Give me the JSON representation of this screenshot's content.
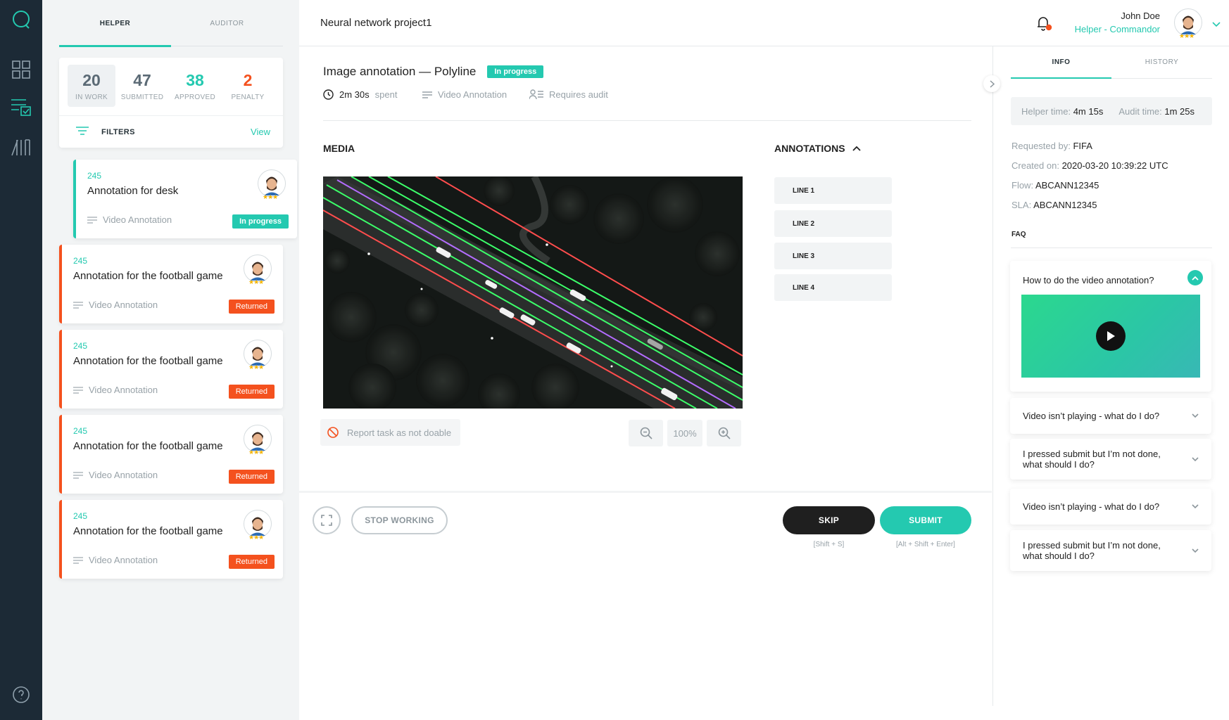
{
  "rail": {
    "icons": [
      "logo-icon",
      "dashboard-icon",
      "tasks-icon",
      "library-icon",
      "help-icon"
    ]
  },
  "tasklist": {
    "tabs": [
      "HELPER",
      "AUDITOR"
    ],
    "stats": [
      {
        "value": "20",
        "label": "IN WORK",
        "color": "#5b6a75"
      },
      {
        "value": "47",
        "label": "SUBMITTED",
        "color": "#5b6a75"
      },
      {
        "value": "38",
        "label": "APPROVED",
        "color": "#24c9b0"
      },
      {
        "value": "2",
        "label": "PENALTY",
        "color": "#f4511e"
      }
    ],
    "filters_label": "FILTERS",
    "filters_view": "View",
    "cards": [
      {
        "id": "245",
        "title": "Annotation for desk",
        "type": "Video Annotation",
        "status": "In progress"
      },
      {
        "id": "245",
        "title": "Annotation for the football game",
        "type": "Video Annotation",
        "status": "Returned"
      },
      {
        "id": "245",
        "title": "Annotation for the football game",
        "type": "Video Annotation",
        "status": "Returned"
      },
      {
        "id": "245",
        "title": "Annotation for the football game",
        "type": "Video Annotation",
        "status": "Returned"
      },
      {
        "id": "245",
        "title": "Annotation for the football game",
        "type": "Video Annotation",
        "status": "Returned"
      }
    ]
  },
  "header": {
    "project": "Neural network project1",
    "user_name": "John Doe",
    "user_role": "Helper - Commandor"
  },
  "task": {
    "title": "Image annotation — Polyline",
    "status": "In progress",
    "time_value": "2m 30s",
    "time_suffix": "spent",
    "type": "Video Annotation",
    "audit": "Requires audit",
    "media_label": "MEDIA",
    "annotations_label": "ANNOTATIONS",
    "annotations": [
      "LINE 1",
      "LINE 2",
      "LINE 3",
      "LINE 4"
    ],
    "report": "Report task as not doable",
    "zoom": "100%"
  },
  "footer": {
    "stop": "STOP WORKING",
    "skip": "SKIP",
    "skip_hint": "[Shift + S]",
    "submit": "SUBMIT",
    "submit_hint": "[Alt + Shift + Enter]"
  },
  "info": {
    "tabs": [
      "INFO",
      "HISTORY"
    ],
    "helper_time_label": "Helper time:",
    "helper_time": "4m 15s",
    "audit_time_label": "Audit time:",
    "audit_time": "1m 25s",
    "requested_by_label": "Requested by:",
    "requested_by": "FIFA",
    "created_label": "Created on:",
    "created": "2020-03-20 10:39:22 UTC",
    "flow_label": "Flow:",
    "flow": "ABCANN12345",
    "sla_label": "SLA:",
    "sla": "ABCANN12345",
    "faq_label": "FAQ",
    "faqs": [
      "How to do the video annotation?",
      "Video isn’t playing - what do I do?",
      "I pressed submit but I’m not done, what should I do?",
      "Video isn’t playing - what do I do?",
      "I pressed submit but I’m not done, what should I do?"
    ]
  },
  "colors": {
    "accent": "#24c9b0",
    "danger": "#f4511e",
    "rail": "#1c2a36"
  }
}
